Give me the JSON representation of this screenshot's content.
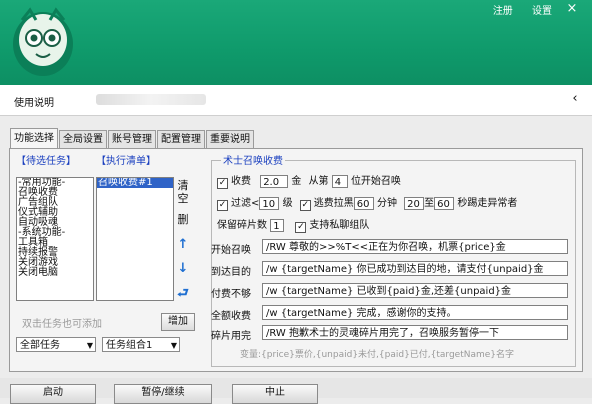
{
  "header": {
    "links": [
      "注册",
      "设置"
    ],
    "close": "×"
  },
  "help_bar": {
    "label": "使用说明",
    "collapse": "‹"
  },
  "tabs": [
    "功能选择",
    "全局设置",
    "账号管理",
    "配置管理",
    "重要说明"
  ],
  "left": {
    "pending_title": "【待选任务】",
    "pending_items": [
      "-常用功能-",
      "召唤收费",
      "广告组队",
      "仪式辅助",
      "自动吸魂",
      "-系统功能-",
      "工具箱",
      "持续报警",
      "关闭游戏",
      "关闭电脑"
    ],
    "exec_title": "【执行清单】",
    "exec_items": [
      "召唤收费#1"
    ],
    "clear": "清空",
    "delete": "删",
    "up": "↑",
    "down": "↓",
    "loop": "⮐",
    "hint": "双击任务也可添加",
    "add": "增加",
    "all_tasks": "全部任务",
    "task_group": "任务组合1"
  },
  "group": {
    "title": "术士召唤收费",
    "charge_label": "收费",
    "charge_value": "2.0",
    "gold": "金",
    "from_label": "从第",
    "from_value": "4",
    "from_suffix": "位开始召唤",
    "filter_label": "过滤<",
    "filter_value": "10",
    "level": "级",
    "flee_label": "逃费拉黑",
    "flee_value": "60",
    "minutes": "分钟",
    "range_from": "20",
    "range_to": "60",
    "range_label": "秒踢走异常者",
    "keep_label": "保留碎片数",
    "keep_value": "1",
    "private_label": "支持私聊组队",
    "rows": [
      {
        "label": "开始召唤",
        "text": "/RW 尊敬的>>%T<<正在为你召唤，机票{price}金"
      },
      {
        "label": "到达目的",
        "text": "/w {targetName} 你已成功到达目的地，请支付{unpaid}金"
      },
      {
        "label": "付费不够",
        "text": "/w {targetName} 已收到{paid}金,还差{unpaid}金"
      },
      {
        "label": "全额收费",
        "text": "/w {targetName} 完成，感谢你的支持。"
      },
      {
        "label": "碎片用完",
        "text": "/RW 抱歉术士的灵魂碎片用完了，召唤服务暂停一下"
      }
    ],
    "vars": "变量:{price}票价,{unpaid}未付,{paid}已付,{targetName}名字"
  },
  "bottom": {
    "buttons": [
      "启动",
      "暂停/继续",
      "中止"
    ]
  },
  "colors": {
    "header": "#12a070",
    "accent": "#1a3fbf",
    "selection": "#2f63c7"
  }
}
